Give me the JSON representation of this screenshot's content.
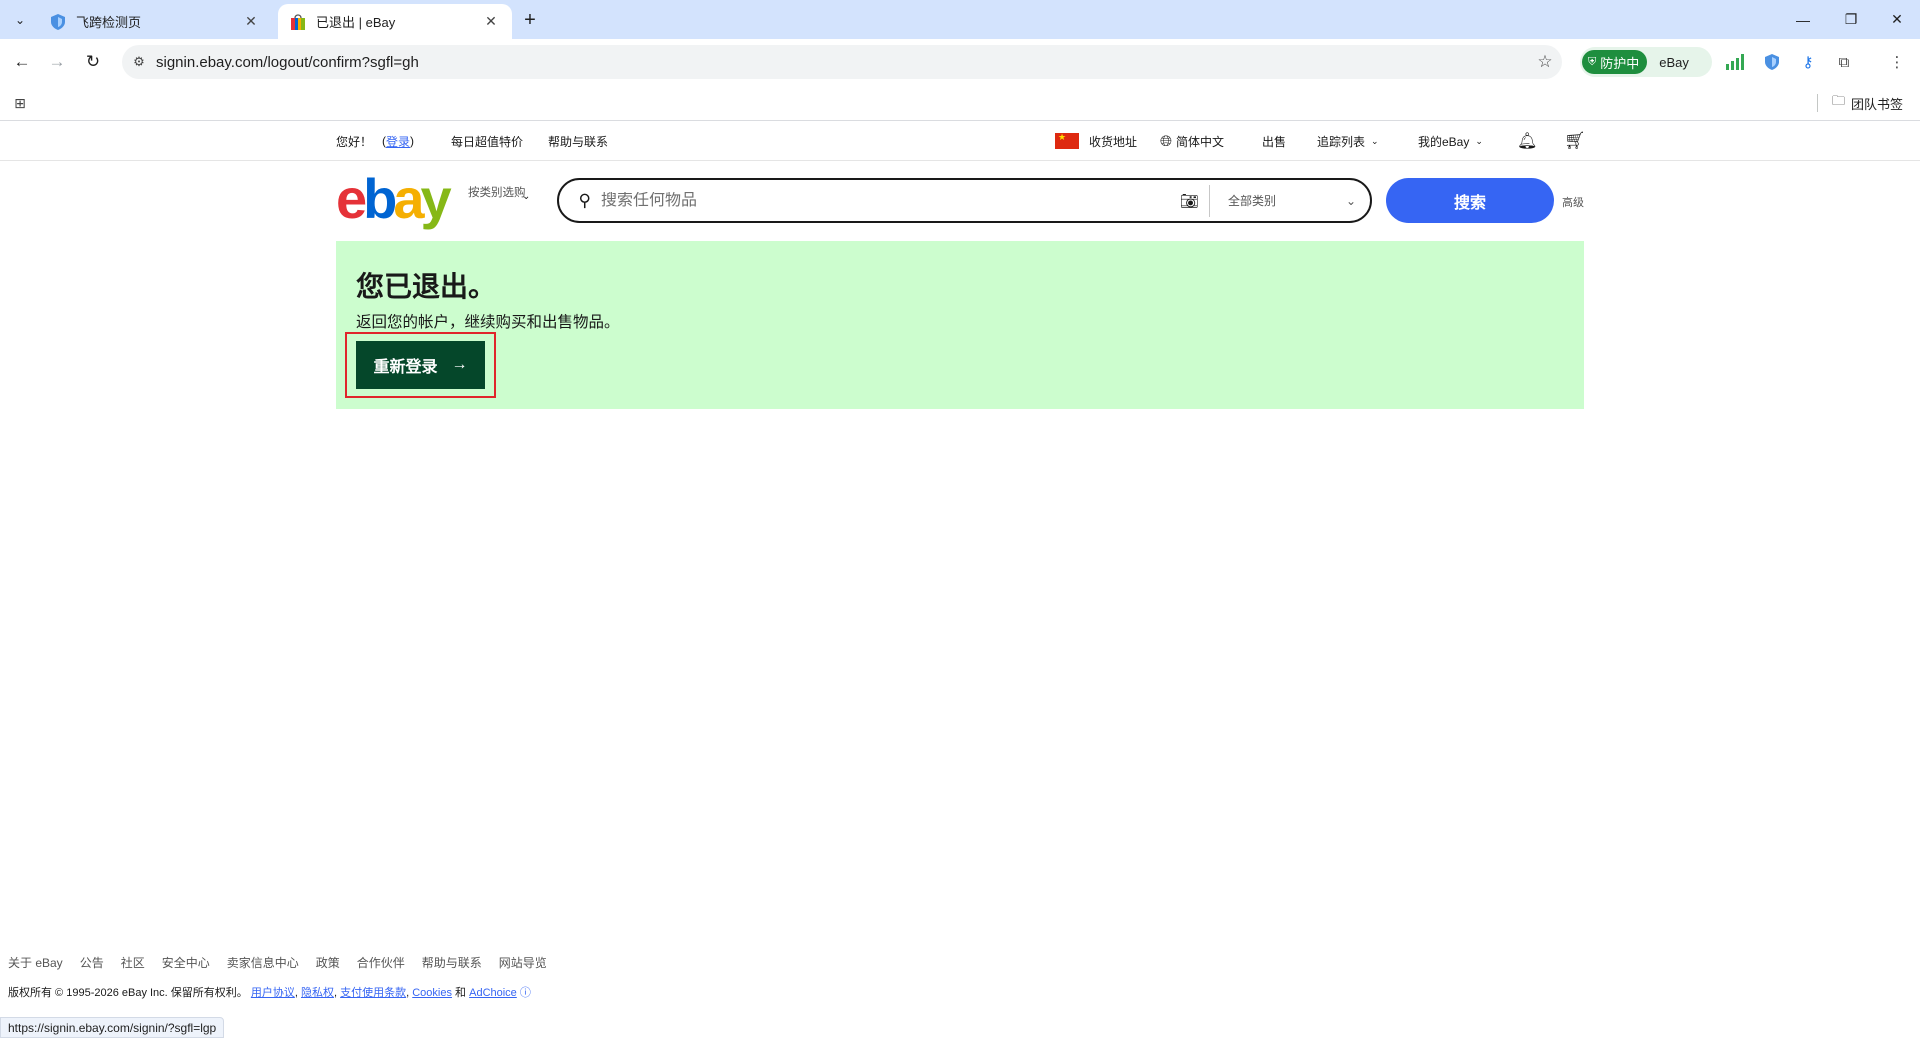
{
  "browser": {
    "tabs": [
      {
        "title": "飞跨检测页",
        "active": false
      },
      {
        "title": "已退出 | eBay",
        "active": true
      }
    ],
    "url": "signin.ebay.com/logout/confirm?sgfl=gh",
    "extension_protect": {
      "label": "防护中",
      "site": "eBay"
    },
    "bookmark_folder": "团队书签",
    "status_url": "https://signin.ebay.com/signin/?sgfl=lgp",
    "icons": [
      "tab-list-icon",
      "close-icon",
      "new-tab-icon",
      "minimize-icon",
      "restore-icon",
      "back-icon",
      "forward-icon",
      "reload-icon",
      "site-info-icon",
      "star-icon",
      "signal-bars-icon",
      "shield-icon",
      "key-icon",
      "extensions-icon",
      "menu-icon",
      "apps-icon",
      "folder-icon"
    ]
  },
  "ebay": {
    "topnav": {
      "greeting": "您好！",
      "paren_open": "(",
      "signin_link": "登录",
      "paren_close": ")",
      "daily_deals": "每日超值特价",
      "help": "帮助与联系",
      "ship_to": "收货地址",
      "language": "简体中文",
      "sell": "出售",
      "watchlist": "追踪列表",
      "my_ebay": "我的eBay"
    },
    "header": {
      "logo_letters": [
        "e",
        "b",
        "a",
        "y"
      ],
      "shop_by_category": "按类别选购",
      "search_placeholder": "搜索任何物品",
      "category_select": "全部类别",
      "search_button": "搜索",
      "advanced": "高级"
    },
    "banner": {
      "title": "您已退出。",
      "subtitle": "返回您的帐户，继续购买和出售物品。",
      "relogin_button": "重新登录"
    },
    "footer": {
      "links": [
        "关于 eBay",
        "公告",
        "社区",
        "安全中心",
        "卖家信息中心",
        "政策",
        "合作伙伴",
        "帮助与联系",
        "网站导览"
      ],
      "copyright": "版权所有 © 1995-2026 eBay Inc. 保留所有权利。",
      "user_agreement": "用户协议",
      "privacy": "隐私权",
      "payments_terms": "支付使用条款",
      "cookies": "Cookies",
      "and": "和",
      "adchoice": "AdChoice"
    },
    "colors": {
      "brand_blue": "#3665f3",
      "banner_bg": "#ccfdce",
      "button_green": "#05472a",
      "highlight_red": "#e0262b"
    }
  }
}
